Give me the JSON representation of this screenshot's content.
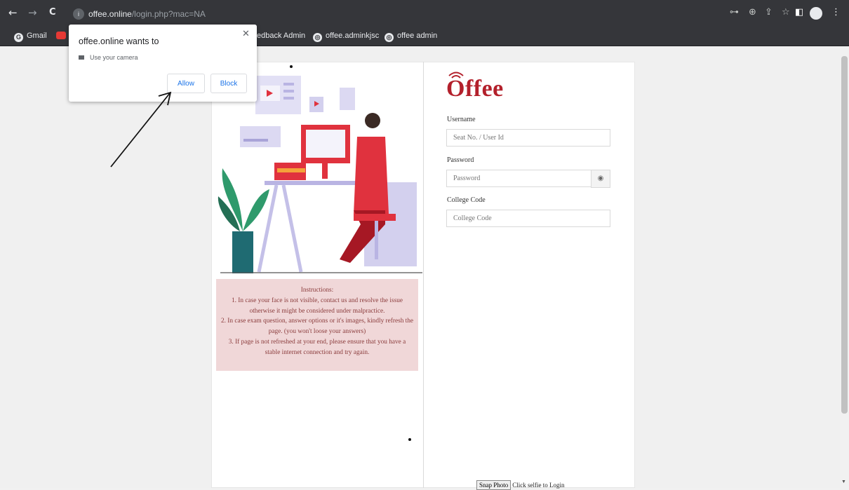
{
  "browser": {
    "url_host": "offee.online",
    "url_path": "/login.php?mac=NA",
    "bookmarks": {
      "gmail": "Gmail",
      "feedback": "edback Admin",
      "adminkjsc": "offee.adminkjsc",
      "offee_admin": "offee admin"
    }
  },
  "permission_popup": {
    "title": "offee.online wants to",
    "permission": "Use your camera",
    "allow_label": "Allow",
    "block_label": "Block",
    "close_glyph": "✕"
  },
  "instructions": {
    "heading": "Instructions:",
    "items": [
      "1. In case your face is not visible, contact us and resolve the issue otherwise it might be considered under malpractice.",
      "2. In case exam question, answer options or it's images, kindly refresh the page. (you won't loose your answers)",
      "3. If page is not refreshed at your end, please ensure that you have a stable internet connection and try again."
    ]
  },
  "login": {
    "logo_text": "Offee",
    "username_label": "Username",
    "username_placeholder": "Seat No. / User Id",
    "password_label": "Password",
    "password_placeholder": "Password",
    "college_label": "College Code",
    "college_placeholder": "College Code",
    "snap_button": "Snap Photo",
    "snap_hint": "Click selfie to Login"
  },
  "colors": {
    "brand": "#b3202b",
    "instructions_bg": "#f0d7d8",
    "chrome_bg": "#35363a"
  },
  "icons": {
    "back": "←",
    "forward": "→",
    "reload": "C",
    "eye": "eye-icon",
    "camera": "camera-icon"
  }
}
